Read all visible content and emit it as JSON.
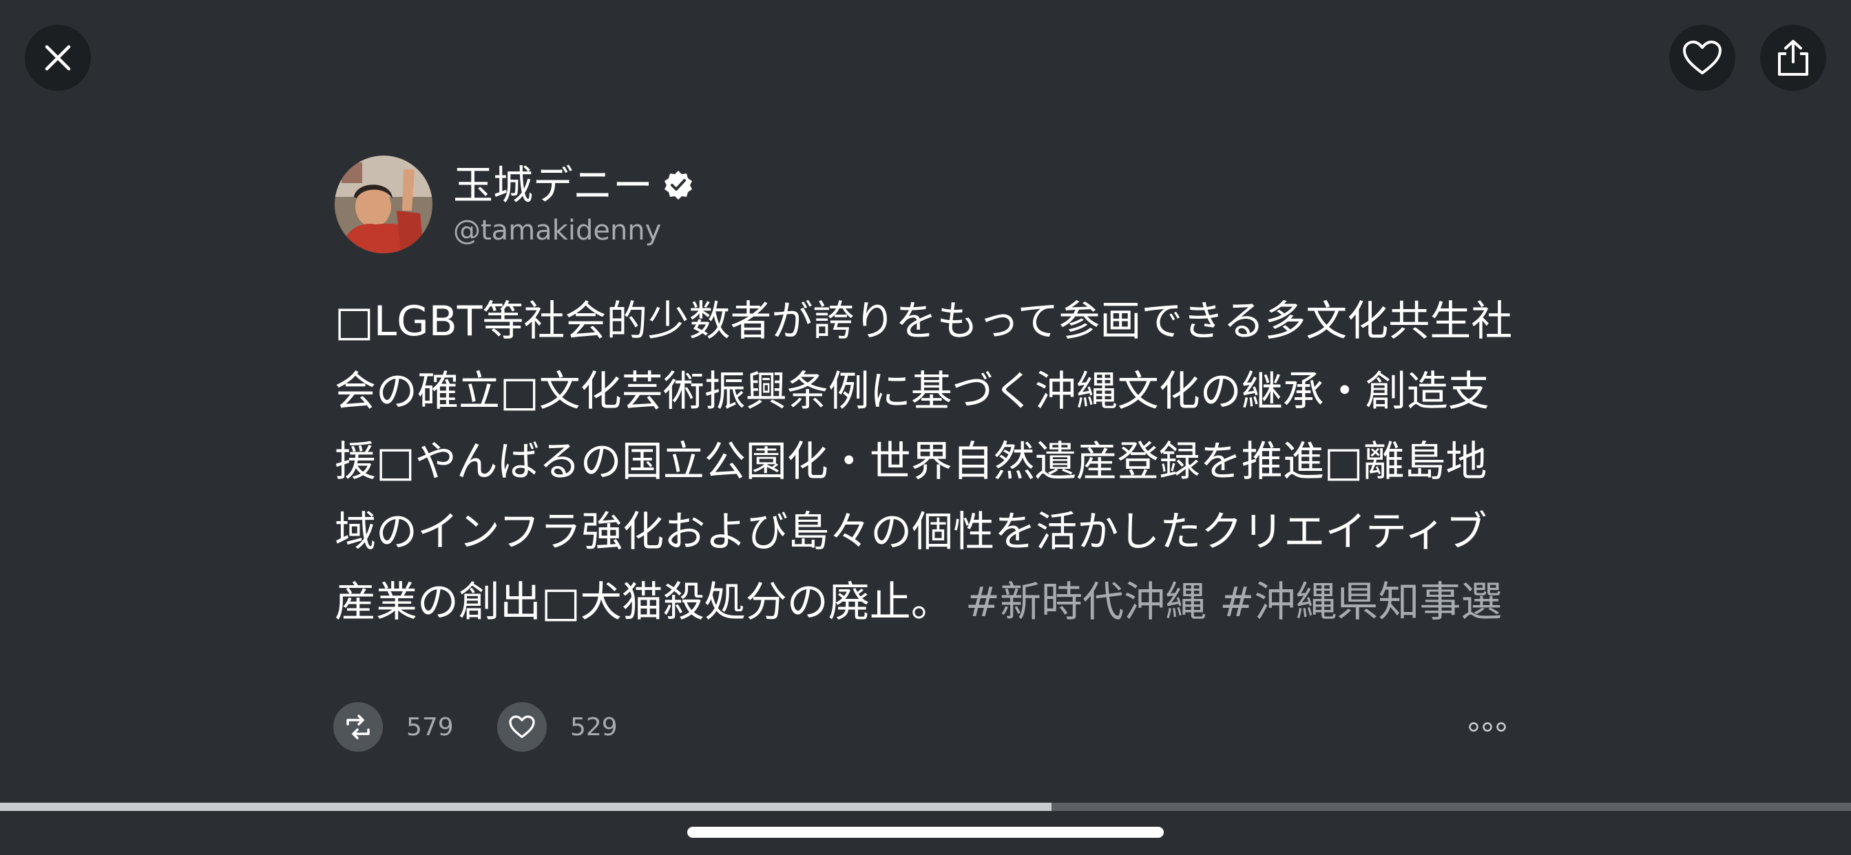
{
  "header": {
    "close_icon": "close-icon",
    "favorite_icon": "heart-icon",
    "share_icon": "share-icon"
  },
  "tweet": {
    "author": {
      "display_name": "玉城デニー",
      "handle": "@tamakidenny",
      "verified": true,
      "verified_icon": "verified-badge-icon"
    },
    "text": "□LGBT等社会的少数者が誇りをもって参画できる多文化共生社会の確立□文化芸術振興条例に基づく沖縄文化の継承・創造支援□やんばるの国立公園化・世界自然遺産登録を推進□離島地域のインフラ強化および島々の個性を活かしたクリエイティブ産業の創出□犬猫殺処分の廃止。",
    "hashtags": [
      "#新時代沖縄",
      "#沖縄県知事選"
    ],
    "retweet_count": "579",
    "like_count": "529"
  },
  "media_progress": {
    "fraction": 0.568
  },
  "colors": {
    "background": "#2b2f33",
    "button_background": "#1c1f22",
    "secondary_text": "#a7acb1",
    "action_icon_background": "#50555a"
  }
}
